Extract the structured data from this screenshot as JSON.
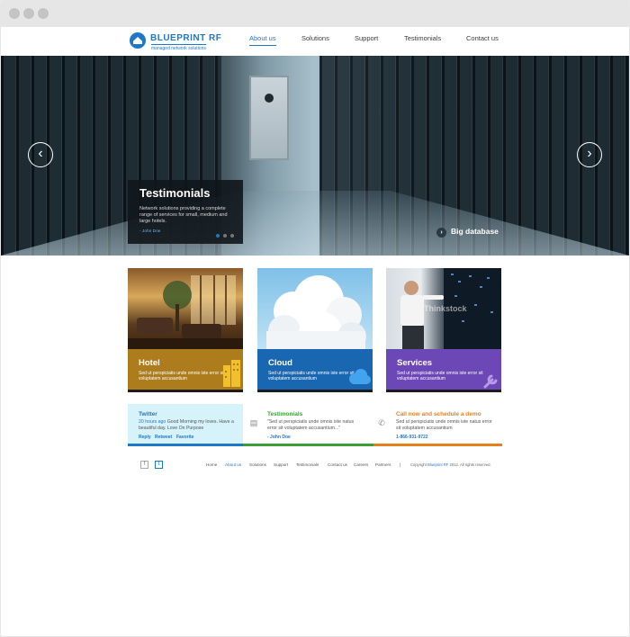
{
  "brand": {
    "name": "BLUEPRINT RF",
    "tagline": "managed network solutions",
    "color": "#1f77c8"
  },
  "nav": [
    {
      "label": "About us",
      "active": true
    },
    {
      "label": "Solutions",
      "active": false
    },
    {
      "label": "Support",
      "active": false
    },
    {
      "label": "Testimonials",
      "active": false
    },
    {
      "label": "Contact us",
      "active": false
    }
  ],
  "hero": {
    "card_title": "Testimonials",
    "card_text": "Network solutions providing a complete range of services for small, medium and large hotels.",
    "card_author": "- John Doe",
    "caption": "Big database",
    "prev_icon": "chevron-left-icon",
    "next_icon": "chevron-right-icon",
    "slide_count": 3,
    "active_slide": 1
  },
  "cards": [
    {
      "title": "Hotel",
      "text": "Sed ut perspiciatis unde omnis iste error sit voluptatem accusantium",
      "color": "#ad7d1d"
    },
    {
      "title": "Cloud",
      "text": "Sed ut perspiciatis unde omnis iste error sit voluptatem accusantium",
      "color": "#1a67b1"
    },
    {
      "title": "Services",
      "text": "Sed ut perspiciatis unde omnis iste error sit voluptatem accusantium",
      "color": "#6c47b6"
    }
  ],
  "watermark": "Thinkstock",
  "info": {
    "twitter": {
      "title": "Twitter",
      "time": "20 hours ago",
      "text": "Good Morning my loves. Have a beautiful day. Love On Purpose",
      "reply": "Reply",
      "retweet": "Retweet",
      "favorite": "Favorite",
      "color": "#1f77c8"
    },
    "testimonials": {
      "title": "Testimonials",
      "text": "\"Sed ut perspiciatis unde omnis iste natus error sit voluptatem accusantium...\"",
      "author": "- John Doe",
      "color": "#3aa035"
    },
    "demo": {
      "title": "Call now and schedule a demo",
      "text": "Sed ut perspiciatis unde omnis iste natus error sit voluptatem accusantium",
      "phone": "1-866-931-9722",
      "color": "#e6801d"
    }
  },
  "footer": {
    "links": [
      "Home",
      "About us",
      "Solutions",
      "Support",
      "Testimonials",
      "Contact us",
      "Careers",
      "Partners"
    ],
    "active_index": 1,
    "separator": "|",
    "copyright_prefix": "Copyright",
    "copyright_brand": "Blueprint RF",
    "copyright_suffix": "2012. All rights reserved.",
    "icon_facebook": "f",
    "icon_twitter": "t"
  }
}
